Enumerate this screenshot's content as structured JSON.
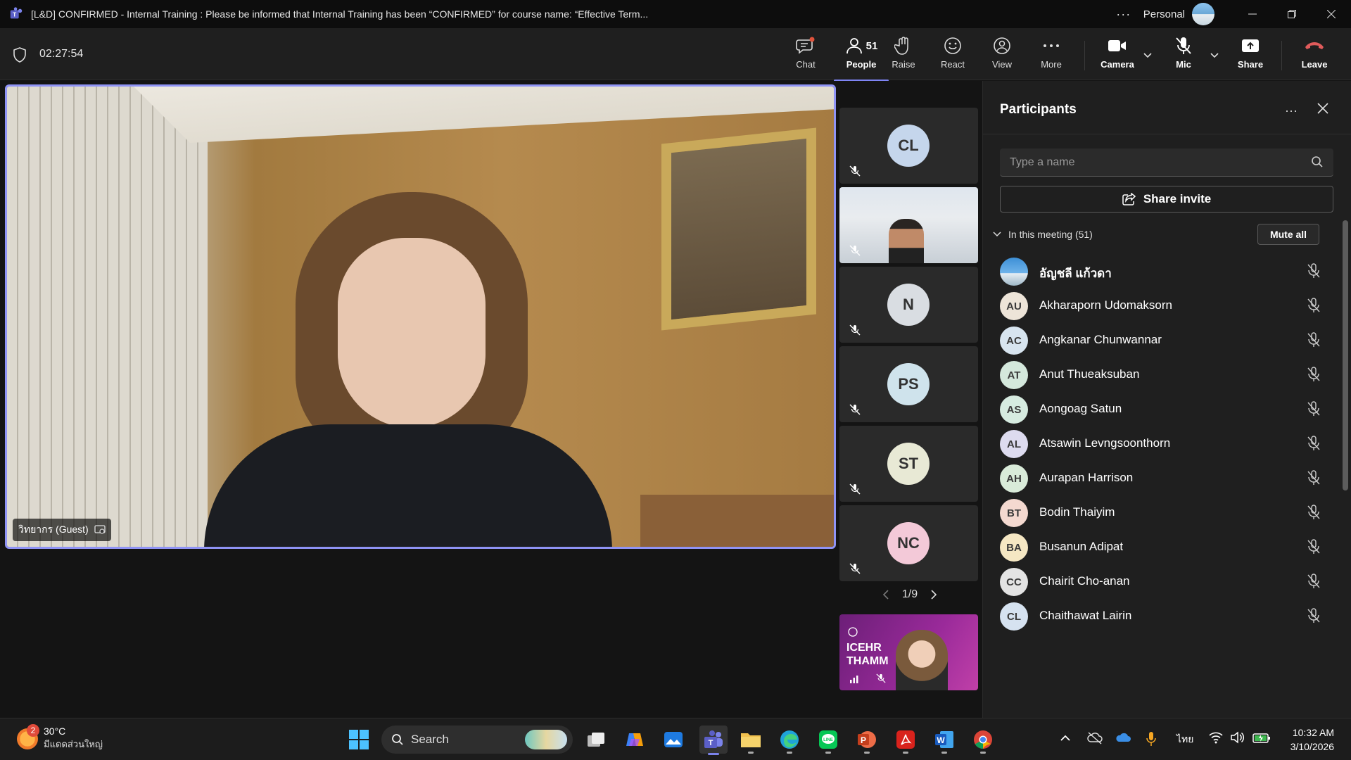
{
  "titlebar": {
    "title": "[L&D] CONFIRMED - Internal Training : Please be informed that Internal Training has been “CONFIRMED” for course name: “Effective Term...",
    "account_label": "Personal"
  },
  "toolbar": {
    "timer": "02:27:54",
    "chat": "Chat",
    "people": "People",
    "people_count": "51",
    "raise": "Raise",
    "react": "React",
    "view": "View",
    "more": "More",
    "camera": "Camera",
    "mic": "Mic",
    "share": "Share",
    "leave": "Leave"
  },
  "main_video": {
    "name_tag": "วิทยากร (Guest)"
  },
  "gallery": {
    "tiles": [
      {
        "initials": "CL",
        "color": "#c5d6ec"
      },
      {
        "initials": "",
        "color": "#cfd9e3"
      },
      {
        "initials": "N",
        "color": "#d9dde2"
      },
      {
        "initials": "PS",
        "color": "#cfe3ec"
      },
      {
        "initials": "ST",
        "color": "#e8e9d5"
      },
      {
        "initials": "NC",
        "color": "#f3c9d8"
      }
    ],
    "pager": "1/9",
    "promo_text_line1": "ICEHR",
    "promo_text_line2": "THAMM"
  },
  "panel": {
    "title": "Participants",
    "search_placeholder": "Type a name",
    "share_invite": "Share invite",
    "in_meeting": "In this meeting (51)",
    "mute_all": "Mute all",
    "participants": [
      {
        "initials": "",
        "name": "อัญชลี แก้วดา",
        "color": "#5aa6e0"
      },
      {
        "initials": "AU",
        "name": "Akharaporn Udomaksorn",
        "color": "#ede4d8"
      },
      {
        "initials": "AC",
        "name": "Angkanar Chunwannar",
        "color": "#d7e4ef"
      },
      {
        "initials": "AT",
        "name": "Anut Thueaksuban",
        "color": "#d4e8dc"
      },
      {
        "initials": "AS",
        "name": "Aongoag Satun",
        "color": "#d6ebe0"
      },
      {
        "initials": "AL",
        "name": "Atsawin Levngsoonthorn",
        "color": "#dddbef"
      },
      {
        "initials": "AH",
        "name": "Aurapan Harrison",
        "color": "#d9ebd9"
      },
      {
        "initials": "BT",
        "name": "Bodin Thaiyim",
        "color": "#f4d9d0"
      },
      {
        "initials": "BA",
        "name": "Busanun Adipat",
        "color": "#f5e7c3"
      },
      {
        "initials": "CC",
        "name": "Chairit Cho-anan",
        "color": "#e3e3e3"
      },
      {
        "initials": "CL",
        "name": "Chaithawat Lairin",
        "color": "#d6e2f0"
      }
    ]
  },
  "taskbar": {
    "weather_badge": "2",
    "temperature": "30°C",
    "condition": "มีแดดส่วนใหญ่",
    "search": "Search",
    "language": "ไทย",
    "time": "10:32 AM",
    "date": "3/10/2026"
  }
}
